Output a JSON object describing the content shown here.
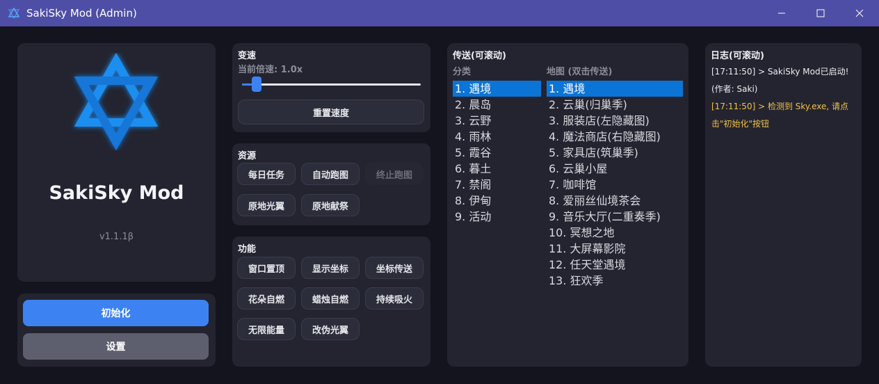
{
  "window": {
    "title": "SakiSky Mod (Admin)",
    "controls": {
      "minimize": "—",
      "maximize": "☐",
      "close": "✕"
    }
  },
  "brand": {
    "name": "SakiSky Mod",
    "version": "v1.1.1β",
    "logo_icon": "star-of-david-icon"
  },
  "actions": {
    "init_label": "初始化",
    "settings_label": "设置"
  },
  "speed": {
    "title": "变速",
    "current_label": "当前倍速: 1.0x",
    "slider_value": 0.08,
    "reset_label": "重置速度"
  },
  "resources": {
    "title": "资源",
    "buttons": [
      {
        "label": "每日任务",
        "enabled": true
      },
      {
        "label": "自动跑图",
        "enabled": true
      },
      {
        "label": "终止跑图",
        "enabled": false
      },
      {
        "label": "原地光翼",
        "enabled": true
      },
      {
        "label": "原地献祭",
        "enabled": true
      }
    ]
  },
  "features": {
    "title": "功能",
    "buttons": [
      {
        "label": "窗口置顶"
      },
      {
        "label": "显示坐标"
      },
      {
        "label": "坐标传送"
      },
      {
        "label": "花朵自燃"
      },
      {
        "label": "蜡烛自燃"
      },
      {
        "label": "持续吸火"
      },
      {
        "label": "无限能量"
      },
      {
        "label": "改伪光翼"
      }
    ]
  },
  "teleport": {
    "title": "传送(可滚动)",
    "category_header": "分类",
    "map_header": "地图 (双击传送)",
    "categories": [
      "1. 遇境",
      "2. 晨岛",
      "3. 云野",
      "4. 雨林",
      "5. 霞谷",
      "6. 暮土",
      "7. 禁阁",
      "8. 伊甸",
      "9. 活动"
    ],
    "selected_category": 0,
    "maps": [
      "1. 遇境",
      "2. 云巢(归巢季)",
      "3. 服装店(左隐藏图)",
      "4. 魔法商店(右隐藏图)",
      "5. 家具店(筑巢季)",
      "6. 云巢小屋",
      "7. 咖啡馆",
      "8. 爱丽丝仙境茶会",
      "9. 音乐大厅(二重奏季)",
      "10. 冥想之地",
      "11. 大屏幕影院",
      "12. 任天堂遇境",
      "13. 狂欢季"
    ],
    "selected_map": 0
  },
  "log": {
    "title": "日志(可滚动)",
    "lines": [
      {
        "text": "[17:11:50] > SakiSky Mod已启动!",
        "level": "info"
      },
      {
        "text": "(作者: Saki)",
        "level": "info"
      },
      {
        "text": "[17:11:50] > 检测到 Sky.exe, 请点",
        "level": "warn"
      },
      {
        "text": "击\"初始化\"按钮",
        "level": "warn"
      }
    ]
  },
  "colors": {
    "accent": "#3d82f2",
    "selection": "#0b74d7",
    "titlebar": "#4e4ea6",
    "warning": "#f2c144"
  }
}
